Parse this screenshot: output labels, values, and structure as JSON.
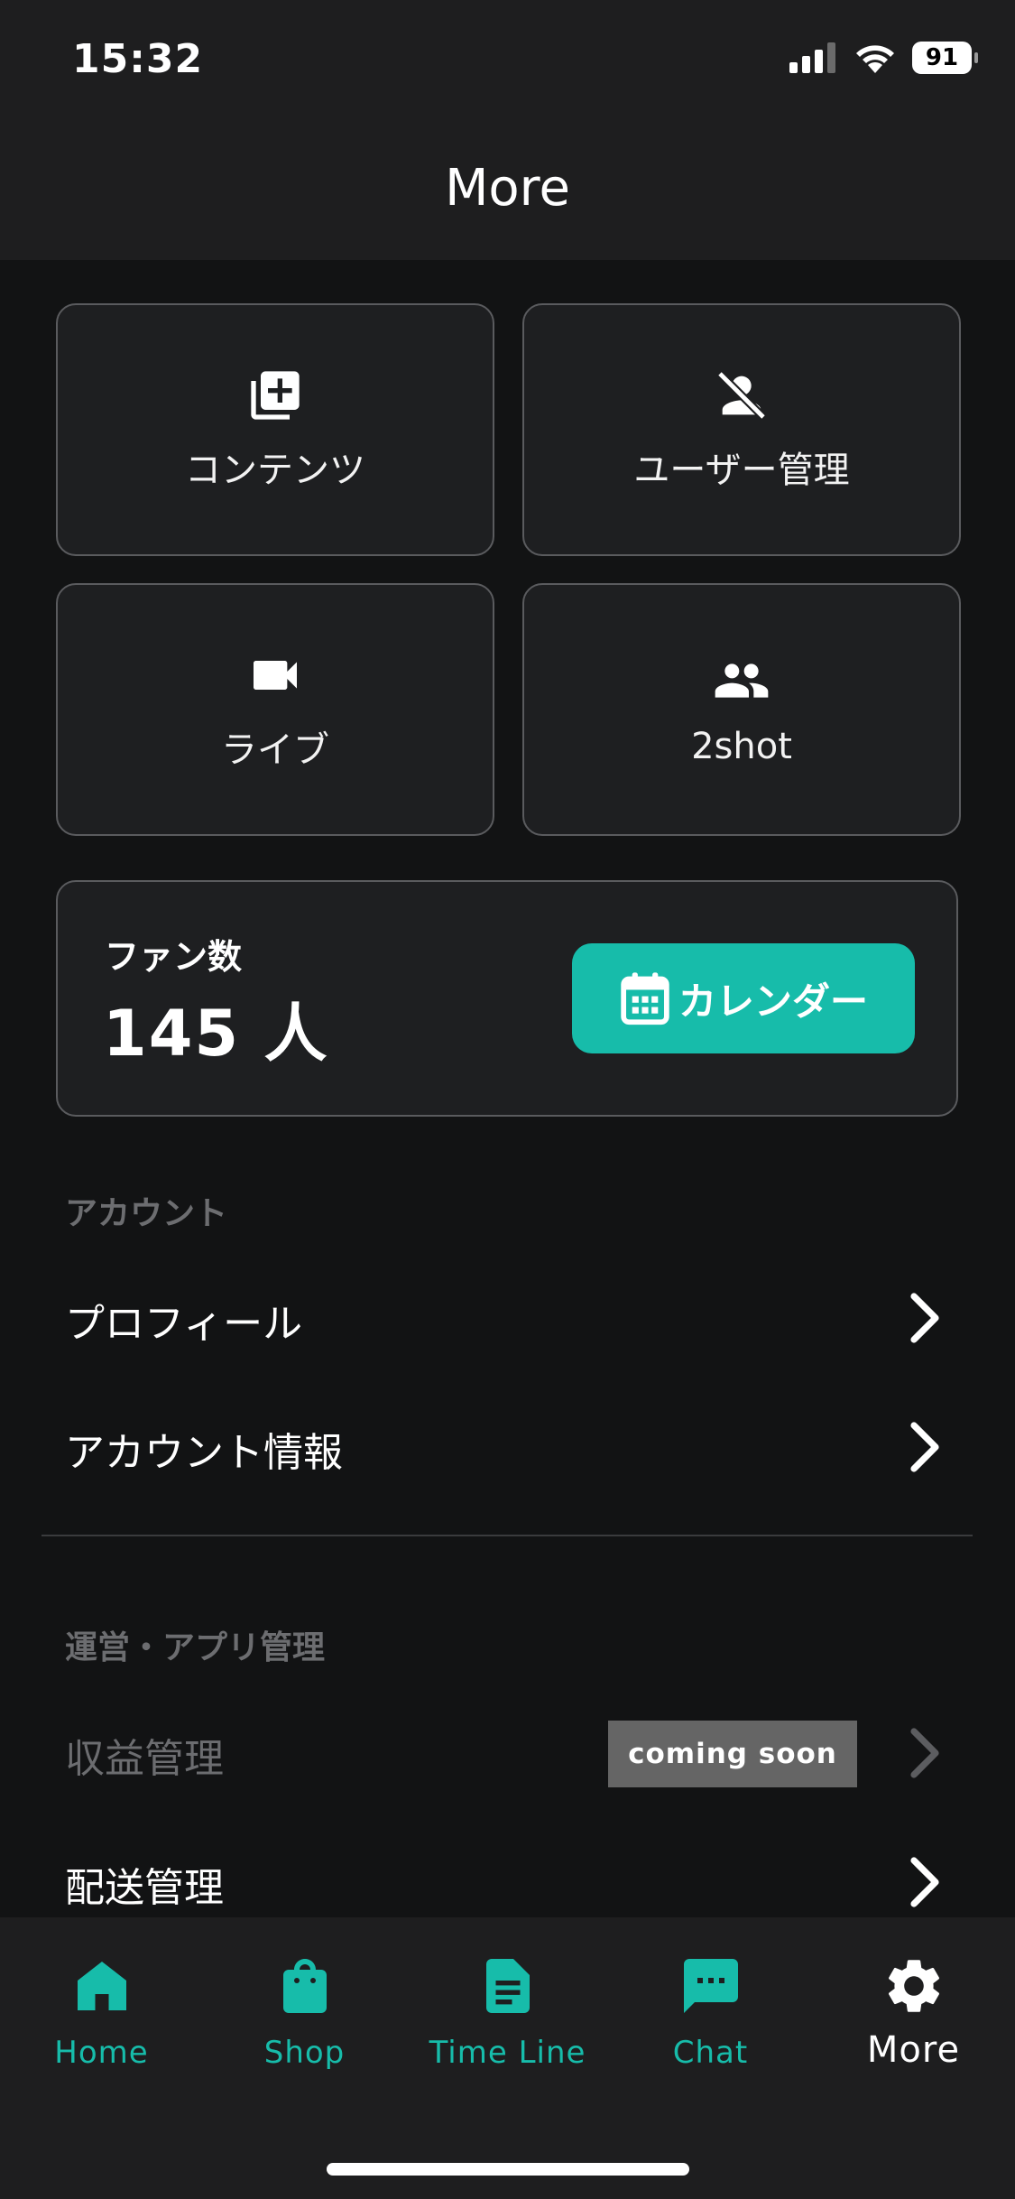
{
  "status_bar": {
    "time": "15:32",
    "battery": "91"
  },
  "header": {
    "title": "More"
  },
  "tiles": [
    {
      "label": "コンテンツ",
      "icon": "add-to-library-icon"
    },
    {
      "label": "ユーザー管理",
      "icon": "person-off-icon"
    },
    {
      "label": "ライブ",
      "icon": "video-camera-icon"
    },
    {
      "label": "2shot",
      "icon": "people-icon"
    }
  ],
  "fans": {
    "label": "ファン数",
    "count": "145 人"
  },
  "calendar_button": {
    "label": "カレンダー",
    "icon": "calendar-icon",
    "color": "#17bcaa"
  },
  "account_section": {
    "title": "アカウント",
    "items": [
      {
        "label": "プロフィール"
      },
      {
        "label": "アカウント情報"
      }
    ]
  },
  "admin_section": {
    "title": "運営・アプリ管理",
    "items": [
      {
        "label": "収益管理",
        "badge": "coming soon",
        "disabled": true
      },
      {
        "label": "配送管理"
      }
    ]
  },
  "bottom_nav": {
    "items": [
      {
        "label": "Home",
        "icon": "home-icon"
      },
      {
        "label": "Shop",
        "icon": "shopping-bag-icon"
      },
      {
        "label": "Time Line",
        "icon": "document-icon"
      },
      {
        "label": "Chat",
        "icon": "chat-icon"
      },
      {
        "label": "More",
        "icon": "gear-icon",
        "active": true
      }
    ],
    "accent": "#17bcaa"
  }
}
